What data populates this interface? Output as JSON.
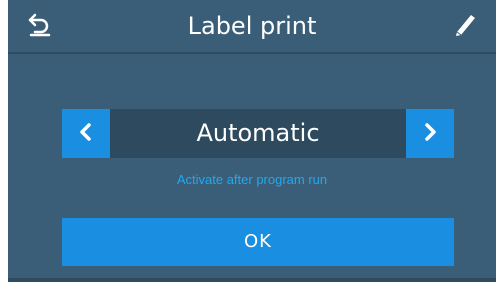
{
  "header": {
    "title": "Label print",
    "back_icon": "back-arrow-icon",
    "edit_icon": "pencil-icon"
  },
  "selector": {
    "value": "Automatic",
    "prev_icon": "chevron-left-icon",
    "next_icon": "chevron-right-icon",
    "hint": "Activate after program run"
  },
  "actions": {
    "ok_label": "OK"
  },
  "colors": {
    "background": "#3a5e78",
    "accent": "#1a8ee0",
    "value_box": "#2d4a5f",
    "hint_text": "#23a8f0"
  }
}
